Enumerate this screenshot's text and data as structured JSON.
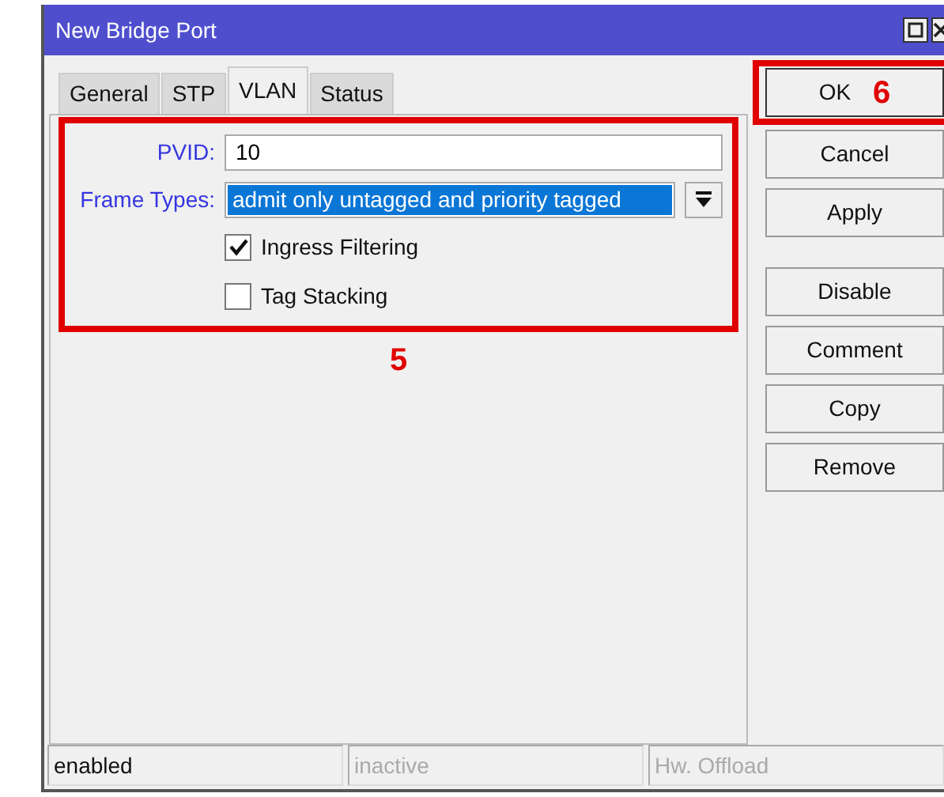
{
  "window": {
    "title": "New Bridge Port"
  },
  "tabs": [
    {
      "label": "General",
      "selected": false
    },
    {
      "label": "STP",
      "selected": false
    },
    {
      "label": "VLAN",
      "selected": true
    },
    {
      "label": "Status",
      "selected": false
    }
  ],
  "form": {
    "pvid": {
      "label": "PVID:",
      "value": "10"
    },
    "frame_types": {
      "label": "Frame Types:",
      "value": "admit only untagged and priority tagged"
    },
    "checkboxes": [
      {
        "label": "Ingress Filtering",
        "checked": true
      },
      {
        "label": "Tag Stacking",
        "checked": false
      }
    ]
  },
  "button_groups": [
    [
      "OK",
      "Cancel",
      "Apply"
    ],
    [
      "Disable",
      "Comment",
      "Copy",
      "Remove"
    ]
  ],
  "annotations": [
    "5",
    "6"
  ],
  "status_bar": [
    {
      "text": "enabled",
      "disabled": false
    },
    {
      "text": "inactive",
      "disabled": true
    },
    {
      "text": "Hw. Offload",
      "disabled": true
    }
  ]
}
